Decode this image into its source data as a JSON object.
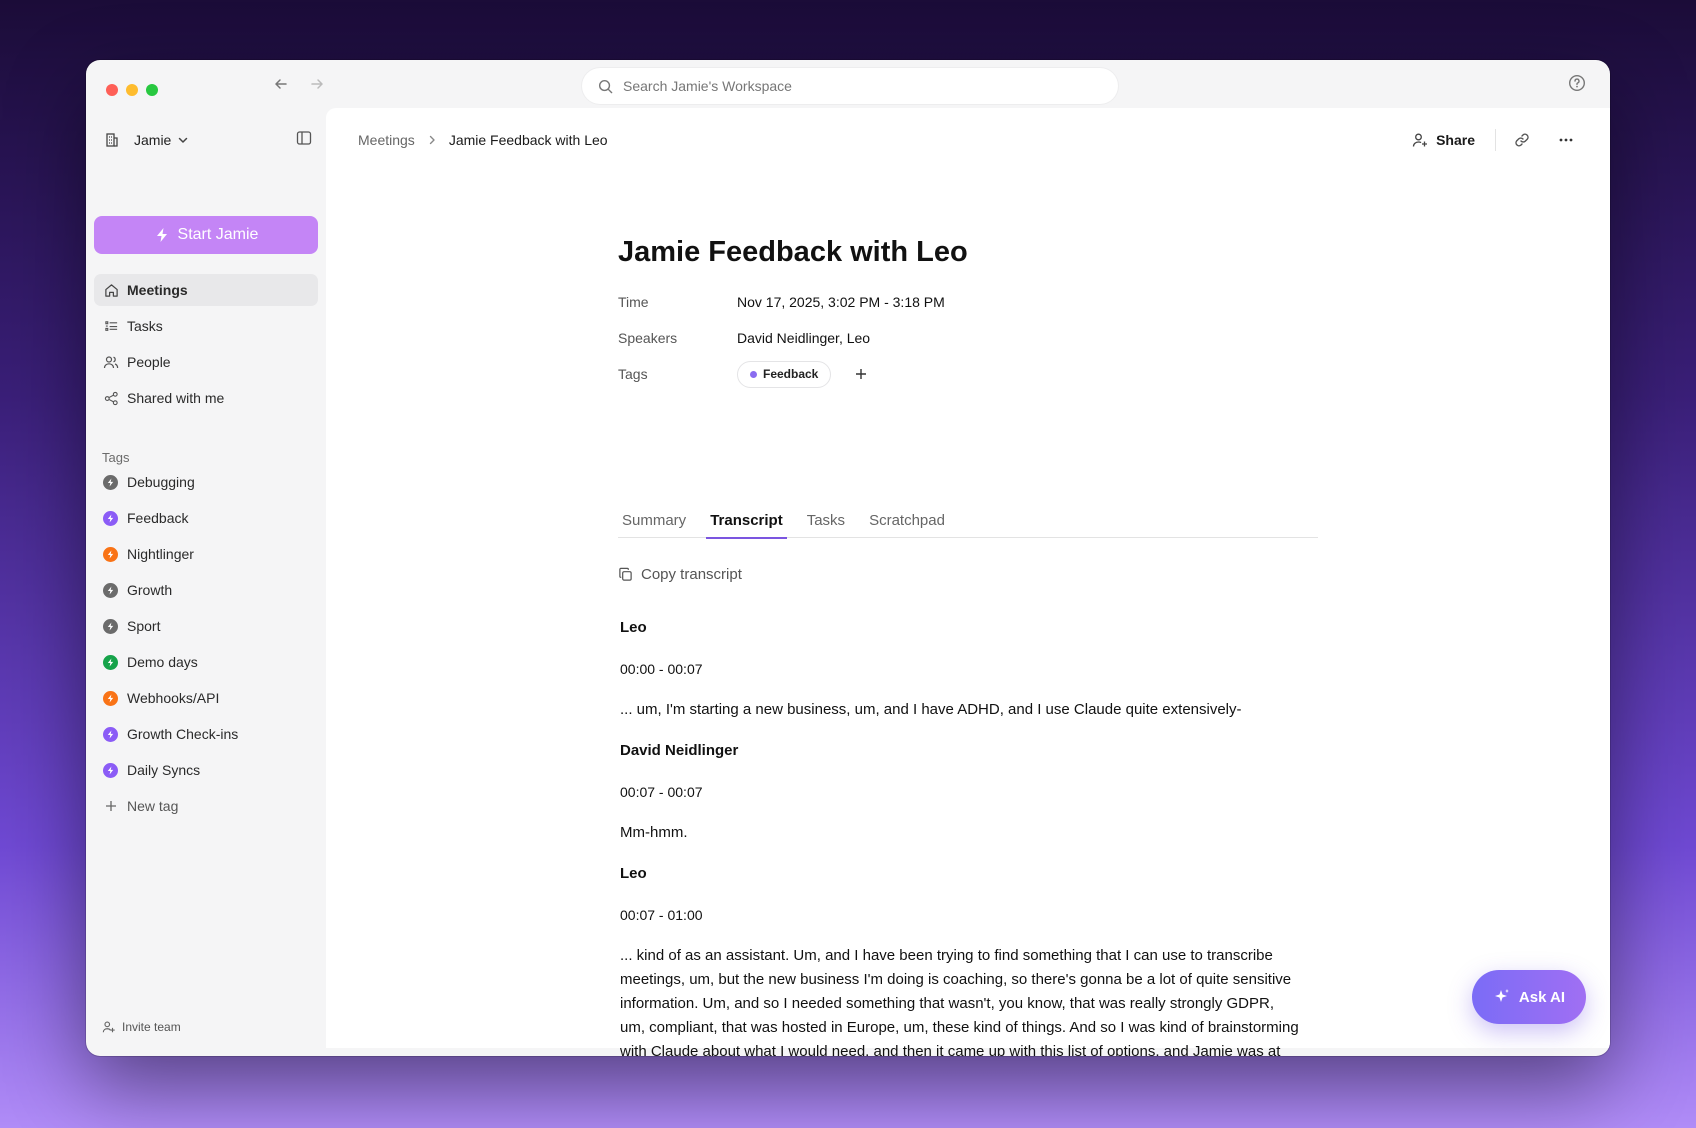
{
  "search": {
    "placeholder": "Search Jamie's Workspace"
  },
  "workspace": {
    "name": "Jamie"
  },
  "sidebar": {
    "start_label": "Start Jamie",
    "items": [
      {
        "label": "Meetings",
        "icon": "home-icon",
        "active": true
      },
      {
        "label": "Tasks",
        "icon": "checklist-icon"
      },
      {
        "label": "People",
        "icon": "people-icon"
      },
      {
        "label": "Shared with me",
        "icon": "share-nodes-icon"
      }
    ],
    "tags_title": "Tags",
    "tags": [
      {
        "label": "Debugging",
        "color": "#6b6b6b"
      },
      {
        "label": "Feedback",
        "color": "#8b5cf6"
      },
      {
        "label": "Nightlinger",
        "color": "#f97316"
      },
      {
        "label": "Growth",
        "color": "#6b6b6b"
      },
      {
        "label": "Sport",
        "color": "#6b6b6b"
      },
      {
        "label": "Demo days",
        "color": "#16a34a"
      },
      {
        "label": "Webhooks/API",
        "color": "#f97316"
      },
      {
        "label": "Growth Check-ins",
        "color": "#8b5cf6"
      },
      {
        "label": "Daily Syncs",
        "color": "#8b5cf6"
      }
    ],
    "new_tag_label": "New tag",
    "invite_label": "Invite team"
  },
  "breadcrumb": {
    "root": "Meetings",
    "current": "Jamie Feedback with Leo"
  },
  "toolbar": {
    "share_label": "Share"
  },
  "meeting": {
    "title": "Jamie Feedback with Leo",
    "time_label": "Time",
    "time_value": "Nov 17, 2025, 3:02 PM - 3:18 PM",
    "speakers_label": "Speakers",
    "speakers_value": "David Neidlinger, Leo",
    "tags_label": "Tags",
    "tag": "Feedback"
  },
  "tabs": [
    "Summary",
    "Transcript",
    "Tasks",
    "Scratchpad"
  ],
  "active_tab": "Transcript",
  "copy_label": "Copy transcript",
  "transcript": [
    {
      "speaker": "Leo",
      "time": "00:00 - 00:07",
      "text": "... um, I'm starting a new business, um, and I have ADHD, and I use Claude quite extensively-"
    },
    {
      "speaker": "David Neidlinger",
      "time": "00:07 - 00:07",
      "text": "Mm-hmm."
    },
    {
      "speaker": "Leo",
      "time": "00:07 - 01:00",
      "text": "... kind of as an assistant. Um, and I have been trying to find something that I can use to transcribe meetings, um, but the new business I'm doing is coaching, so there's gonna be a lot of quite sensitive information. Um, and so I needed something that wasn't, you know, that was really strongly GDPR, um, compliant, that was hosted in Europe, um, these kind of things. And so I was kind of brainstorming with Claude about what I would need, and then it came up with this list of options, and Jamie was at the top. Um, so- Oh, that's amazing. Yeah. Yeah. Um, so, uh, yeah, and then obviously I went and checked, and it was true, you know. You've got really good kind of"
    }
  ],
  "ask_ai_label": "Ask AI",
  "colors": {
    "accent": "#7b55e0",
    "start_button": "#c485f6"
  }
}
